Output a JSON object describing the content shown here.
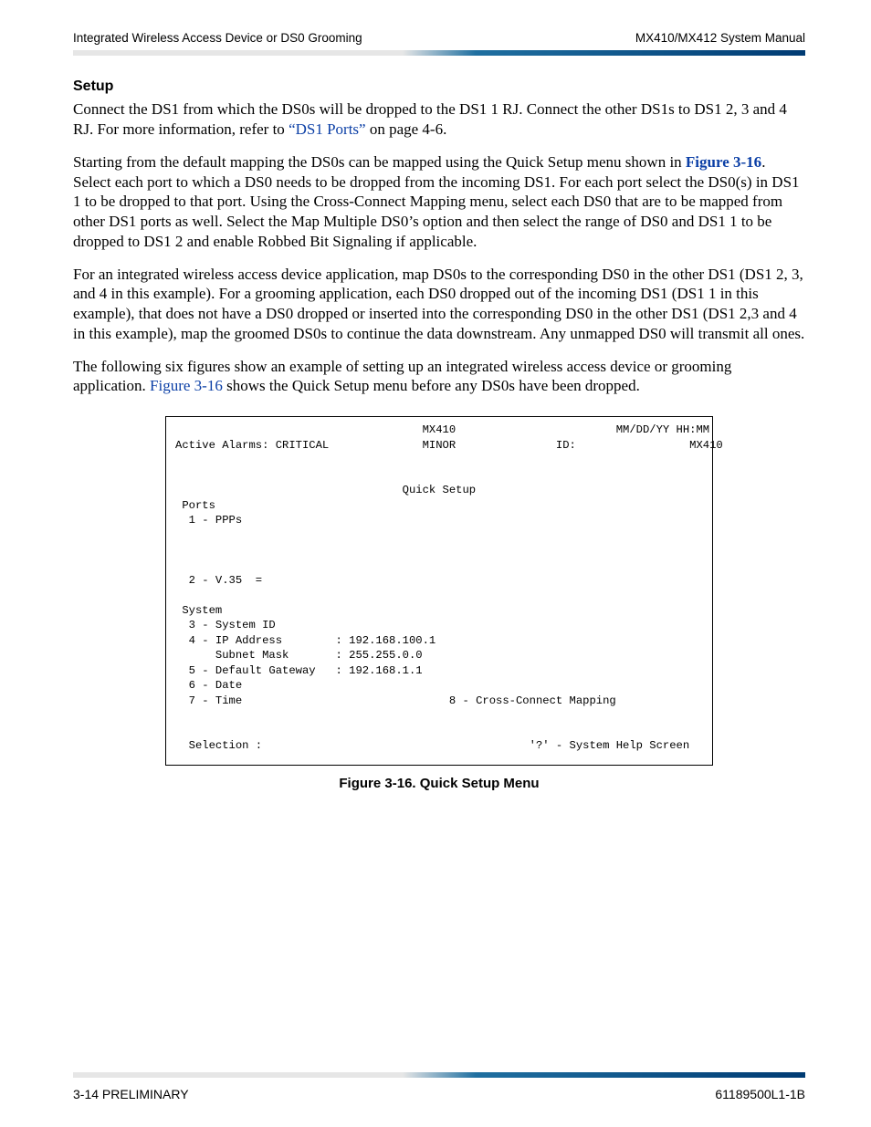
{
  "header": {
    "left": "Integrated Wireless Access Device or DS0 Grooming",
    "right": "MX410/MX412 System Manual"
  },
  "section_title": "Setup",
  "p1a": "Connect the DS1 from which the DS0s will be dropped to the DS1 1 RJ. Connect the other DS1s to DS1 2, 3 and 4 RJ. For more information, refer to ",
  "p1_link": "“DS1 Ports”",
  "p1b": " on page 4-6.",
  "p2a": "Starting from the default mapping the DS0s can be mapped using the Quick Setup menu shown in ",
  "p2_link": "Figure 3-16",
  "p2b": ". Select each port to which a DS0 needs to be dropped from the incoming DS1. For each port select the DS0(s) in DS1 1 to be dropped to that port. Using the Cross-Connect Mapping menu, select each DS0 that are to be mapped from other DS1 ports as well. Select the Map Multiple DS0’s option and then select the range of DS0 and DS1 1 to be dropped to DS1 2 and enable Robbed Bit Signaling if applicable.",
  "p3": "For an integrated wireless access device application, map DS0s to the corresponding DS0 in the other DS1 (DS1 2, 3, and 4 in this example). For a grooming application, each DS0 dropped out of the incoming DS1 (DS1 1 in this example), that does not have a DS0 dropped or inserted into the corresponding DS0 in the other DS1 (DS1 2,3 and 4 in this example), map the groomed DS0s to continue the data downstream. Any unmapped DS0 will transmit all ones.",
  "p4a": "The following six figures show an example of setting up an integrated wireless access device or grooming application. ",
  "p4_link": "Figure 3-16",
  "p4b": " shows the Quick Setup menu before any DS0s have been dropped.",
  "terminal": "                                     MX410                        MM/DD/YY HH:MM\nActive Alarms: CRITICAL              MINOR               ID:                 MX410\n\n\n                                  Quick Setup\n Ports\n  1 - PPPs\n\n\n\n  2 - V.35  =\n\n System\n  3 - System ID\n  4 - IP Address        : 192.168.100.1\n      Subnet Mask       : 255.255.0.0\n  5 - Default Gateway   : 192.168.1.1\n  6 - Date\n  7 - Time                               8 - Cross-Connect Mapping\n\n\n  Selection :                                        '?' - System Help Screen\n",
  "figure_caption": "Figure 3-16.  Quick Setup Menu",
  "footer": {
    "left": "3-14    PRELIMINARY",
    "right": "61189500L1-1B"
  }
}
